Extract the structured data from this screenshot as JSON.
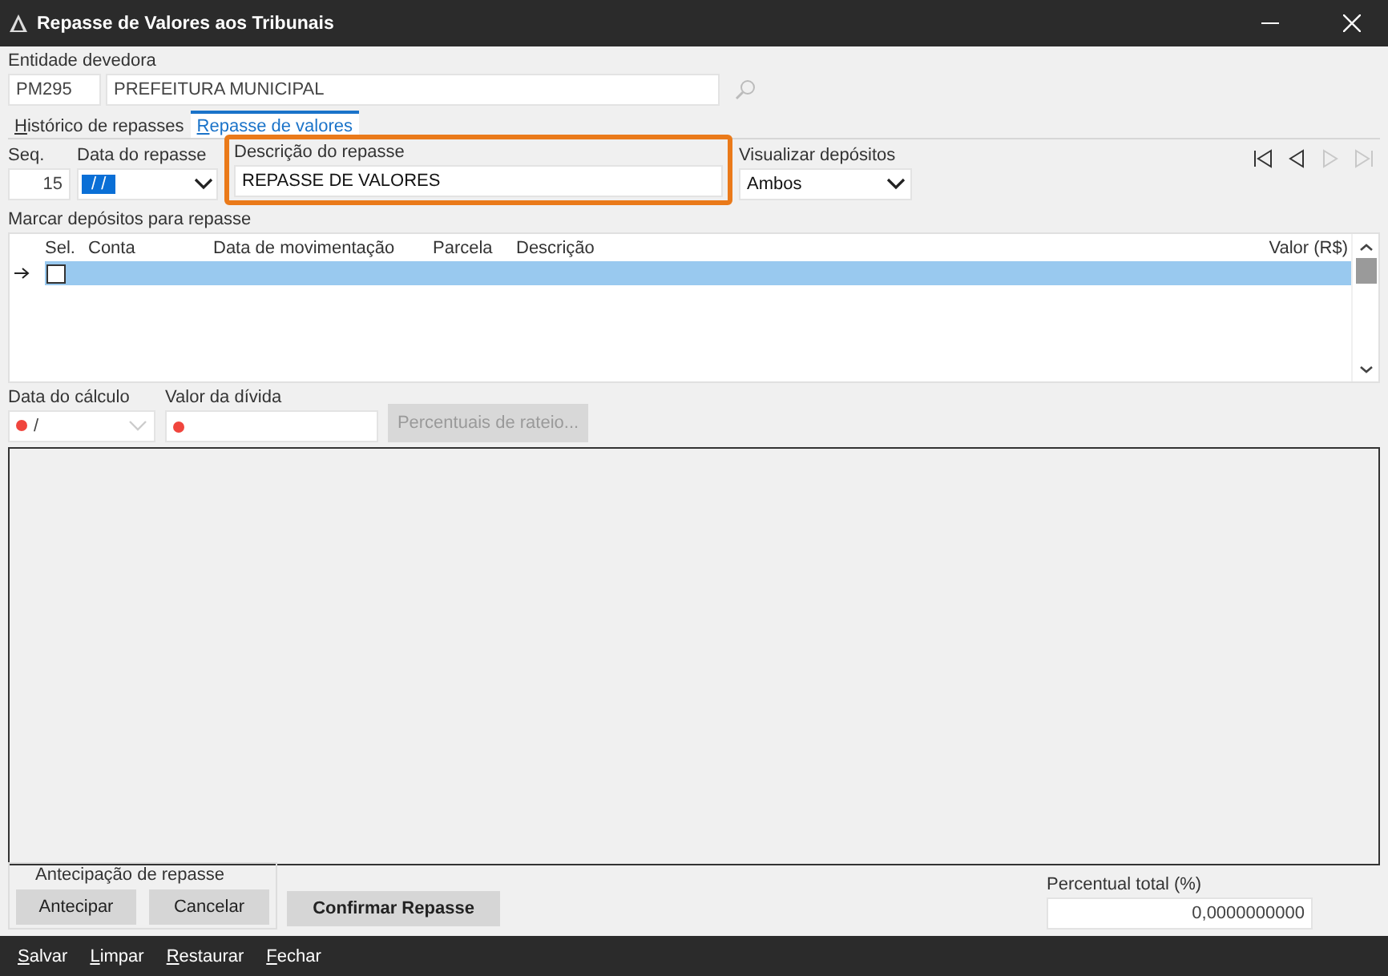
{
  "window": {
    "title": "Repasse de Valores aos Tribunais"
  },
  "entity": {
    "label": "Entidade devedora",
    "code": "PM295",
    "name": "PREFEITURA MUNICIPAL"
  },
  "tabs": [
    {
      "label": "Histórico de repasses",
      "selected": false
    },
    {
      "label": "Repasse de valores",
      "selected": true
    }
  ],
  "form": {
    "seq": {
      "label": "Seq.",
      "value": "15"
    },
    "date": {
      "label": "Data do repasse",
      "value": "/ /",
      "selected": true
    },
    "description": {
      "label": "Descrição do repasse",
      "value": "REPASSE DE VALORES",
      "highlighted": true
    },
    "view": {
      "label": "Visualizar depósitos",
      "value": "Ambos"
    }
  },
  "nav": [
    {
      "kind": "first",
      "disabled": false
    },
    {
      "kind": "prev",
      "disabled": false
    },
    {
      "kind": "next",
      "disabled": true
    },
    {
      "kind": "last",
      "disabled": true
    }
  ],
  "deposits": {
    "label": "Marcar depósitos para repasse",
    "columns": [
      "Sel.",
      "Conta",
      "Data de movimentação",
      "Parcela",
      "Descrição",
      "Valor (R$)"
    ],
    "rows": [
      {
        "current": true,
        "selected": true,
        "checked": false
      }
    ]
  },
  "calc": {
    "date": {
      "label": "Data do cálculo",
      "value": "/",
      "required": true
    },
    "debt": {
      "label": "Valor da dívida",
      "required": true
    },
    "rateio": {
      "label": "Percentuais de rateio...",
      "disabled": true
    }
  },
  "anticipation": {
    "label": "Antecipação de repasse",
    "buttons": [
      "Antecipar",
      "Cancelar"
    ]
  },
  "confirm": {
    "label": "Confirmar Repasse"
  },
  "total": {
    "label": "Percentual total (%)",
    "value": "0,0000000000"
  },
  "footer": [
    "Salvar",
    "Limpar",
    "Restaurar",
    "Fechar"
  ]
}
